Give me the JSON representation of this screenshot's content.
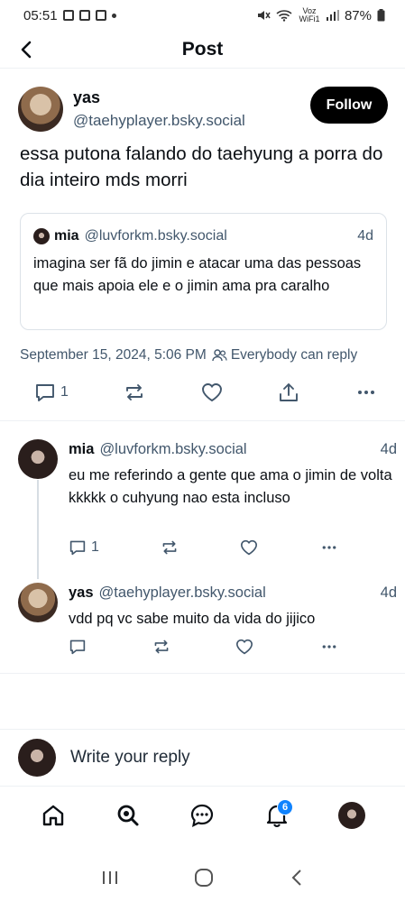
{
  "status_bar": {
    "time": "05:51",
    "network_label": "Voz WiFi1",
    "battery": "87%"
  },
  "header": {
    "title": "Post"
  },
  "post": {
    "author_name": "yas",
    "author_handle": "@taehyplayer.bsky.social",
    "follow_label": "Follow",
    "text": "essa putona falando do taehyung a porra do dia inteiro mds morri",
    "quote": {
      "author_name": "mia",
      "author_handle": "@luvforkm.bsky.social",
      "time": "4d",
      "text": "imagina ser fã do jimin e atacar uma das pessoas que mais apoia ele e o jimin ama pra caralho"
    },
    "timestamp": "September 15, 2024, 5:06 PM",
    "visibility": "Everybody can reply",
    "reply_count": "1"
  },
  "replies": [
    {
      "author_name": "mia",
      "author_handle": "@luvforkm.bsky.social",
      "time": "4d",
      "text": "eu me referindo a gente que ama o jimin de volta kkkkk o cuhyung nao esta incluso",
      "reply_count": "1"
    },
    {
      "author_name": "yas",
      "author_handle": "@taehyplayer.bsky.social",
      "time": "4d",
      "text": "vdd pq vc sabe muito da vida do jijico",
      "reply_count": ""
    }
  ],
  "composer": {
    "placeholder": "Write your reply"
  },
  "tabbar": {
    "notifications_badge": "6"
  },
  "colors": {
    "follow_bg": "#000000",
    "badge": "#1083fe",
    "secondary_text": "#42576c"
  }
}
